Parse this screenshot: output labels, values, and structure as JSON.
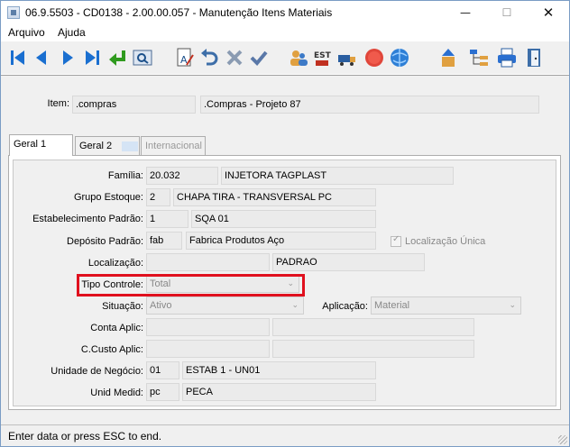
{
  "window": {
    "title": "06.9.5503 - CD0138 - 2.00.00.057 - Manutenção Itens Materiais",
    "minimize": "—",
    "maximize": "☐",
    "close": "✕"
  },
  "menu": {
    "items": [
      "Arquivo",
      "Ajuda"
    ]
  },
  "toolbar": {
    "icons": [
      "first-record-icon",
      "previous-record-icon",
      "next-record-icon",
      "last-record-icon",
      "goto-icon",
      "search-zoom-icon",
      "edit-icon",
      "undo-icon",
      "delete-icon",
      "confirm-icon",
      "users-icon",
      "est-icon",
      "transport-icon",
      "stop-icon",
      "globe-icon",
      "upload-icon",
      "tree-icon",
      "print-icon",
      "exit-icon"
    ]
  },
  "item": {
    "label": "Item:",
    "code": ".compras",
    "description": ".Compras - Projeto 87"
  },
  "tabs": [
    "Geral 1",
    "Geral 2",
    "Internacional"
  ],
  "form": {
    "familia": {
      "label": "Família:",
      "code": "20.032",
      "desc": "INJETORA TAGPLAST"
    },
    "grupo_estoque": {
      "label": "Grupo Estoque:",
      "code": "2",
      "desc": "CHAPA TIRA   - TRANSVERSAL  PC"
    },
    "estabelecimento": {
      "label": "Estabelecimento Padrão:",
      "code": "1",
      "desc": "SQA 01"
    },
    "deposito": {
      "label": "Depósito Padrão:",
      "code": "fab",
      "desc": "Fabrica Produtos Aço"
    },
    "localizacao_unica": {
      "label": "Localização Única",
      "checked": true
    },
    "localizacao": {
      "label": "Localização:",
      "code": "",
      "desc": "PADRAO"
    },
    "tipo_controle": {
      "label": "Tipo Controle:",
      "value": "Total"
    },
    "situacao": {
      "label": "Situação:",
      "value": "Ativo"
    },
    "aplicacao": {
      "label": "Aplicação:",
      "value": "Material"
    },
    "conta_aplic": {
      "label": "Conta Aplic:",
      "code": "",
      "desc": ""
    },
    "ccusto_aplic": {
      "label": "C.Custo Aplic:",
      "code": "",
      "desc": ""
    },
    "unidade_negocio": {
      "label": "Unidade de Negócio:",
      "code": "01",
      "desc": "ESTAB 1 - UN01"
    },
    "unid_medid": {
      "label": "Unid Medid:",
      "code": "pc",
      "desc": "PECA"
    }
  },
  "status": {
    "text": "Enter data or press ESC to end."
  },
  "colors": {
    "highlight": "#e0101e",
    "toolbar_blue": "#1a6fd0"
  }
}
